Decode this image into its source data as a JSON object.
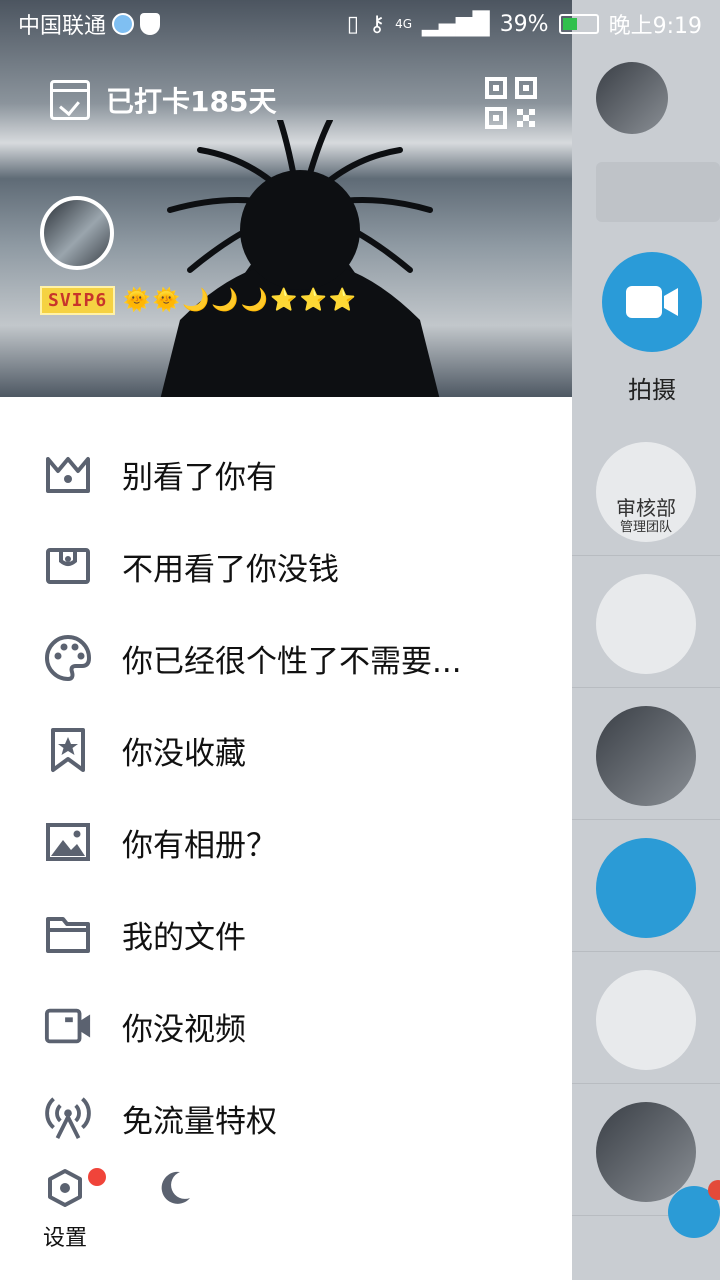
{
  "status_bar": {
    "carrier": "中国联通",
    "network": "4G",
    "battery": "39%",
    "time": "晚上9:19"
  },
  "header": {
    "checkin_text": "已打卡185天",
    "vip_badge": "SVIP6",
    "level_icons": "🌞🌞🌙🌙🌙⭐⭐⭐"
  },
  "menu": {
    "items": [
      {
        "label": "别看了你有",
        "icon": "crown-icon"
      },
      {
        "label": "不用看了你没钱",
        "icon": "wallet-icon"
      },
      {
        "label": "你已经很个性了不需要...",
        "icon": "palette-icon"
      },
      {
        "label": "你没收藏",
        "icon": "bookmark-star-icon"
      },
      {
        "label": "你有相册？",
        "icon": "image-icon"
      },
      {
        "label": "我的文件",
        "icon": "folder-icon"
      },
      {
        "label": "你没视频",
        "icon": "video-icon"
      },
      {
        "label": "免流量特权",
        "icon": "signal-broadcast-icon"
      }
    ]
  },
  "footer": {
    "settings_label": "设置"
  },
  "background_app": {
    "camera_label": "拍摄",
    "group_label_1": "审核部",
    "group_label_2": "管理团队"
  },
  "colors": {
    "icon_gray": "#5b6270",
    "accent_blue": "#2b9bd6",
    "badge_red": "#f0443a"
  }
}
